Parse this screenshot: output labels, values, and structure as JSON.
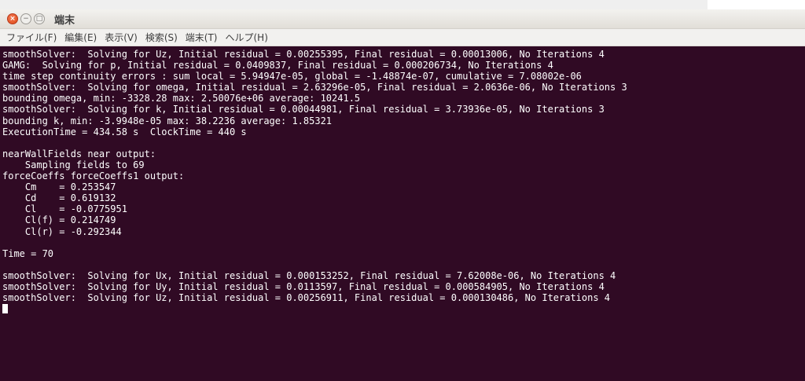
{
  "window": {
    "title": "端末",
    "buttons": {
      "close": "×",
      "minimize": "−",
      "maximize": "□"
    }
  },
  "menu": [
    "ファイル(F)",
    "編集(E)",
    "表示(V)",
    "検索(S)",
    "端末(T)",
    "ヘルプ(H)"
  ],
  "terminal": {
    "lines": [
      "smoothSolver:  Solving for Uz, Initial residual = 0.00255395, Final residual = 0.00013006, No Iterations 4",
      "GAMG:  Solving for p, Initial residual = 0.0409837, Final residual = 0.000206734, No Iterations 4",
      "time step continuity errors : sum local = 5.94947e-05, global = -1.48874e-07, cumulative = 7.08002e-06",
      "smoothSolver:  Solving for omega, Initial residual = 2.63296e-05, Final residual = 2.0636e-06, No Iterations 3",
      "bounding omega, min: -3328.28 max: 2.50076e+06 average: 10241.5",
      "smoothSolver:  Solving for k, Initial residual = 0.00044981, Final residual = 3.73936e-05, No Iterations 3",
      "bounding k, min: -3.9948e-05 max: 38.2236 average: 1.85321",
      "ExecutionTime = 434.58 s  ClockTime = 440 s",
      "",
      "nearWallFields near output:",
      "    Sampling fields to 69",
      "forceCoeffs forceCoeffs1 output:",
      "    Cm    = 0.253547",
      "    Cd    = 0.619132",
      "    Cl    = -0.0775951",
      "    Cl(f) = 0.214749",
      "    Cl(r) = -0.292344",
      "",
      "Time = 70",
      "",
      "smoothSolver:  Solving for Ux, Initial residual = 0.000153252, Final residual = 7.62008e-06, No Iterations 4",
      "smoothSolver:  Solving for Uy, Initial residual = 0.0113597, Final residual = 0.000584905, No Iterations 4",
      "smoothSolver:  Solving for Uz, Initial residual = 0.00256911, Final residual = 0.000130486, No Iterations 4"
    ]
  },
  "colors": {
    "terminal_bg": "#300a24",
    "terminal_fg": "#ffffff",
    "close_button": "#dd4814"
  }
}
